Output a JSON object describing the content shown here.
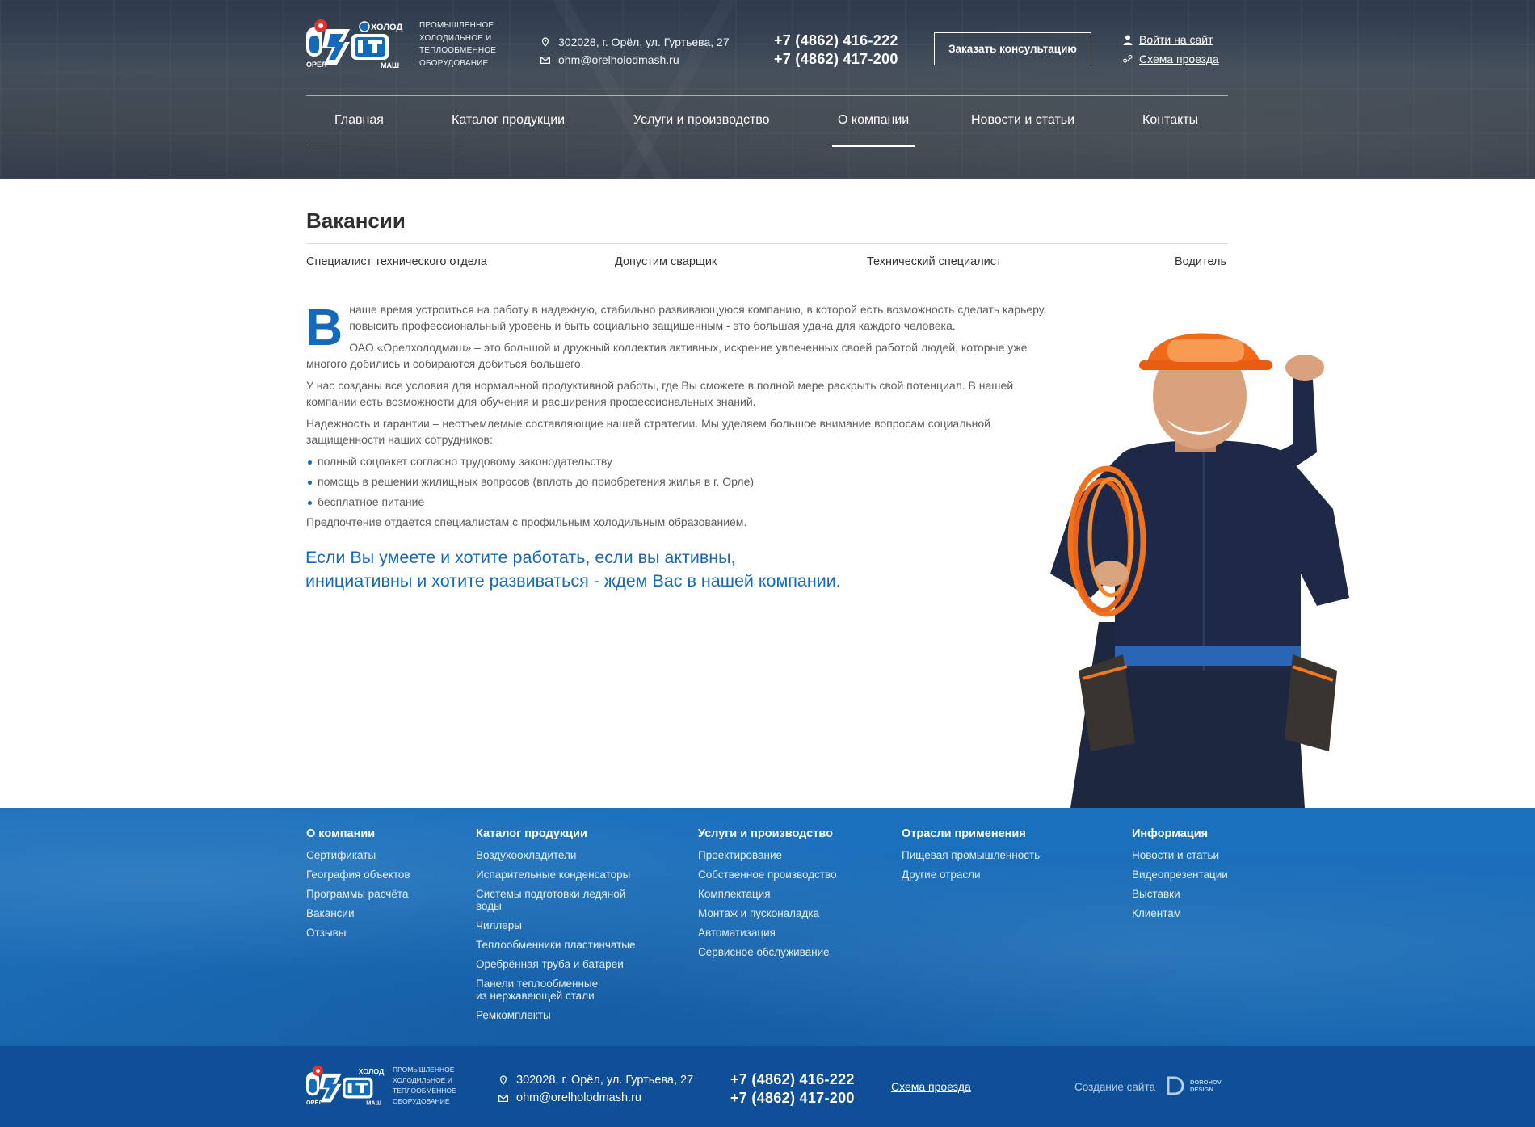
{
  "header": {
    "logo_small": "ОРЁЛ",
    "logo_top": "ХОЛОД",
    "logo_bottom": "МАШ",
    "tagline": [
      "ПРОМЫШЛЕННОЕ",
      "ХОЛОДИЛЬНОЕ И",
      "ТЕПЛООБМЕННОЕ",
      "ОБОРУДОВАНИЕ"
    ],
    "address": "302028, г. Орёл, ул. Гуртьева, 27",
    "email": "ohm@orelholodmash.ru",
    "phone1": "+7 (4862) 416-222",
    "phone2": "+7 (4862) 417-200",
    "cta": "Заказать консультацию",
    "login": "Войти на сайт",
    "route": "Схема проезда"
  },
  "nav": [
    "Главная",
    "Каталог продукции",
    "Услуги и производство",
    "О компании",
    "Новости и статьи",
    "Контакты"
  ],
  "nav_active": "О компании",
  "page": {
    "title": "Вакансии",
    "vacancies": [
      "Специалист технического  отдела",
      "Допустим сварщик",
      "Технический специалист",
      "Водитель"
    ],
    "dropcap": "В",
    "p1": "наше время  устроиться на работу  в надежную, стабильно развивающуюся компанию, в которой есть возможность сделать карьеру, повысить профессиональный уровень и быть социально защищенным - это большая удача для каждого человека.",
    "p2": "ОАО «Орелхолодмаш» – это большой и дружный коллектив активных, искренне увлеченных своей работой людей, которые уже многого добились и собираются добиться большего.",
    "p3": "У нас созданы все условия для нормальной продуктивной работы, где Вы сможете в полной мере раскрыть свой потенциал. В нашей компании есть возможности для обучения и расширения профессиональных знаний.",
    "p4": "Надежность и гарантии – неотъемлемые составляющие нашей стратегии. Мы уделяем большое внимание вопросам социальной защищенности наших сотрудников:",
    "bullets": [
      "полный соцпакет согласно трудовому законодательству",
      "помощь в решении жилищных вопросов (вплоть до приобретения жилья в г. Орле)",
      "бесплатное питание"
    ],
    "p5": "Предпочтение отдается специалистам с профильным холодильным образованием.",
    "quote1": "Если Вы умеете и хотите работать, если вы активны,",
    "quote2": "инициативны и хотите развиваться - ждем Вас в нашей компании."
  },
  "footer": {
    "columns": [
      {
        "title": "О компании",
        "links": [
          "Сертификаты",
          "География объектов",
          "Программы расчёта",
          "Вакансии",
          "Отзывы"
        ]
      },
      {
        "title": "Каталог продукции",
        "links": [
          "Воздухоохладители",
          "Испарительные конденсаторы",
          "Системы подготовки ледяной воды",
          "Чиллеры",
          "Теплообменники пластинчатые",
          "Оребрённая труба и батареи",
          "Панели теплообменные из нержавеющей стали",
          "Ремкомплекты"
        ]
      },
      {
        "title": "Услуги и производство",
        "links": [
          "Проектирование",
          "Собственное производство",
          "Комплектация",
          "Монтаж и пусконаладка",
          "Автоматизация",
          "Сервисное обслуживание"
        ]
      },
      {
        "title": "Отрасли применения",
        "links": [
          "Пищевая промышленность",
          "Другие отрасли"
        ]
      },
      {
        "title": "Информация",
        "links": [
          "Новости и статьи",
          "Видеопрезентации",
          "Выставки",
          "Клиентам"
        ]
      }
    ],
    "made_by": "Создание сайта",
    "studio": [
      "DOROHOV",
      "DESIGN"
    ]
  },
  "colors": {
    "accent": "#1469b8",
    "footer": "#1a6cb5",
    "footer_bottom": "#0e4f97"
  }
}
